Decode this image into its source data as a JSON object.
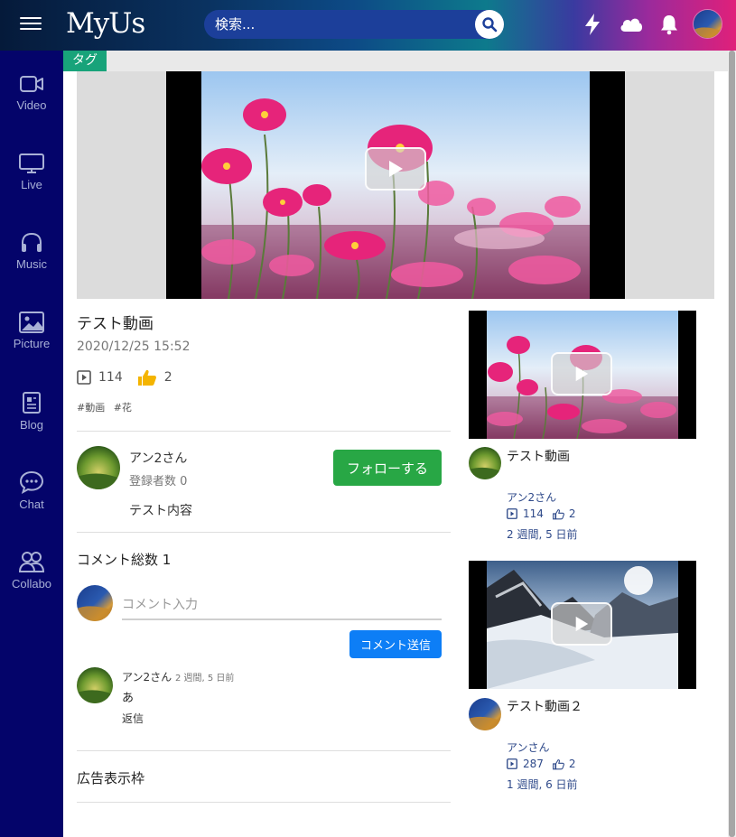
{
  "header": {
    "logo": "MyUs",
    "search_placeholder": "検索...",
    "icons": [
      "menu-icon",
      "search-icon",
      "lightning-icon",
      "cloud-icon",
      "bell-icon",
      "avatar"
    ]
  },
  "sidebar": {
    "items": [
      {
        "label": "Video",
        "icon": "video-icon"
      },
      {
        "label": "Live",
        "icon": "monitor-icon"
      },
      {
        "label": "Music",
        "icon": "headphones-icon"
      },
      {
        "label": "Picture",
        "icon": "image-icon"
      },
      {
        "label": "Blog",
        "icon": "blog-icon"
      },
      {
        "label": "Chat",
        "icon": "chat-icon"
      },
      {
        "label": "Collabo",
        "icon": "people-icon"
      }
    ]
  },
  "tagbar": {
    "tag": "タグ"
  },
  "video": {
    "title": "テスト動画",
    "date": "2020/12/25 15:52",
    "views": "114",
    "likes": "2",
    "tags": [
      "#動画",
      "#花"
    ]
  },
  "channel": {
    "name": "アン2さん",
    "subscribers": "登録者数 0",
    "follow_label": "フォローする",
    "description": "テスト内容"
  },
  "comments": {
    "count_label": "コメント総数 1",
    "input_placeholder": "コメント入力",
    "send_label": "コメント送信",
    "items": [
      {
        "author": "アン2さん",
        "time": "2 週間, 5 日前",
        "text": "あ",
        "reply": "返信"
      }
    ]
  },
  "ad": {
    "label": "広告表示枠"
  },
  "related": [
    {
      "title": "テスト動画",
      "author": "アン2さん",
      "views": "114",
      "likes": "2",
      "time": "2 週間, 5 日前"
    },
    {
      "title": "テスト動画２",
      "author": "アンさん",
      "views": "287",
      "likes": "2",
      "time": "1 週間, 6 日前"
    }
  ],
  "colors": {
    "sidebar": "#04046a",
    "follow": "#28a745",
    "send": "#0d7ef6",
    "tag": "#18a37a",
    "meta": "#2f4a8a"
  }
}
